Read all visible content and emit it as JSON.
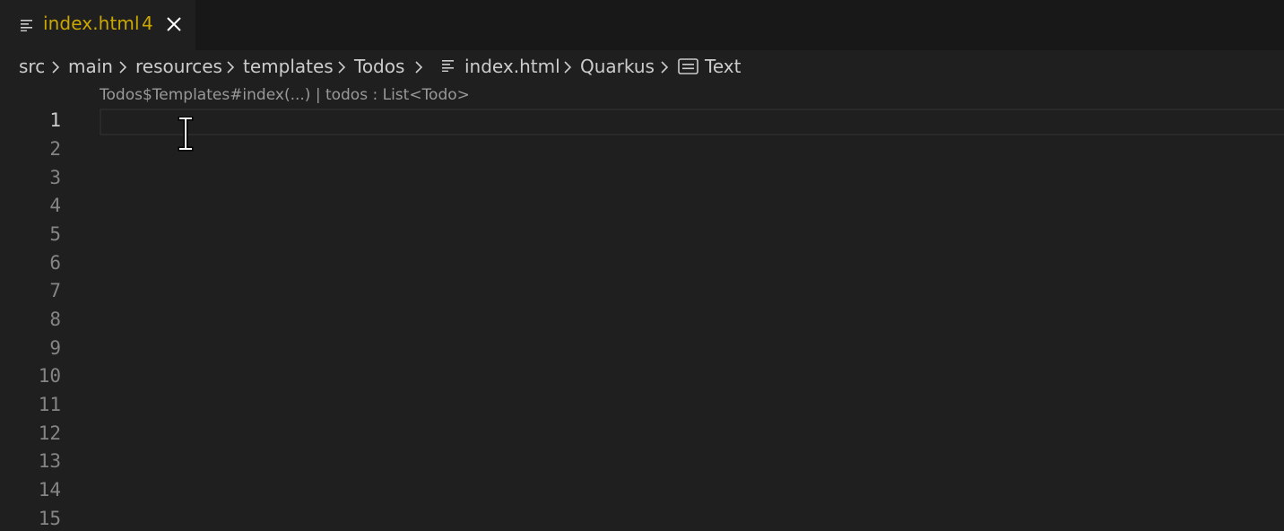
{
  "tab": {
    "icon": "lines-icon",
    "filename": "index.html",
    "problem_count": "4",
    "close_icon": "close-icon"
  },
  "breadcrumb": {
    "items": [
      "src",
      "main",
      "resources",
      "templates",
      "Todos",
      "index.html",
      "Quarkus",
      "Text"
    ],
    "file_icon": "lines-icon",
    "symbol_icon": "text-symbol-icon",
    "separator_icon": "chevron-right-icon"
  },
  "codelens": {
    "text": "Todos$Templates#index(...) | todos : List<Todo>"
  },
  "editor": {
    "line_numbers": [
      "1",
      "2",
      "3",
      "4",
      "5",
      "6",
      "7",
      "8",
      "9",
      "10",
      "11",
      "12",
      "13",
      "14",
      "15"
    ],
    "active_line": "1"
  },
  "colors": {
    "tab_text": "#cca700",
    "editor_bg": "#1f1f1f",
    "tabbar_bg": "#181818"
  }
}
